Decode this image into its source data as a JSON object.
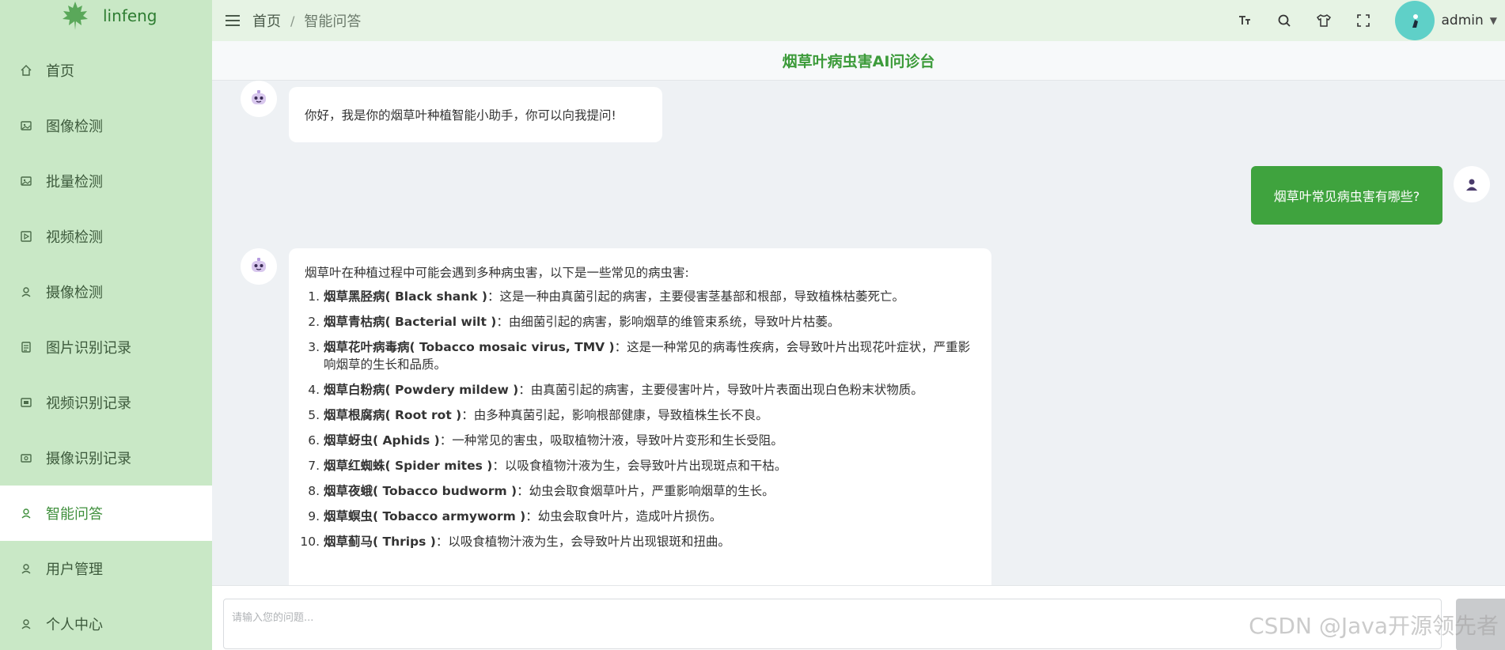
{
  "app": {
    "name": "linfeng"
  },
  "sidebar": {
    "items": [
      {
        "label": "首页",
        "icon": "home-icon"
      },
      {
        "label": "图像检测",
        "icon": "image-icon"
      },
      {
        "label": "批量检测",
        "icon": "image-icon"
      },
      {
        "label": "视频检测",
        "icon": "video-icon"
      },
      {
        "label": "摄像检测",
        "icon": "user-icon"
      },
      {
        "label": "图片识别记录",
        "icon": "document-icon"
      },
      {
        "label": "视频识别记录",
        "icon": "video-record-icon"
      },
      {
        "label": "摄像识别记录",
        "icon": "camera-record-icon"
      },
      {
        "label": "智能问答",
        "icon": "user-icon",
        "active": true
      },
      {
        "label": "用户管理",
        "icon": "user-icon"
      },
      {
        "label": "个人中心",
        "icon": "user-icon"
      }
    ]
  },
  "header": {
    "breadcrumb": [
      "首页",
      "智能问答"
    ],
    "breadcrumb_separator": "/",
    "user_name": "admin"
  },
  "chat": {
    "title": "烟草叶病虫害AI问诊台",
    "greeting": "你好，我是你的烟草叶种植智能小助手，你可以向我提问!",
    "user_question": "烟草叶常见病虫害有哪些?",
    "answer_intro": "烟草叶在种植过程中可能会遇到多种病虫害，以下是一些常见的病虫害:",
    "answer_items": [
      {
        "name": "烟草黑胫病",
        "en": "( Black shank )",
        "desc": "：这是一种由真菌引起的病害，主要侵害茎基部和根部，导致植株枯萎死亡。"
      },
      {
        "name": "烟草青枯病",
        "en": "( Bacterial wilt )",
        "desc": "：由细菌引起的病害，影响烟草的维管束系统，导致叶片枯萎。"
      },
      {
        "name": "烟草花叶病毒病",
        "en": "( Tobacco mosaic virus, TMV )",
        "desc": "：这是一种常见的病毒性疾病，会导致叶片出现花叶症状，严重影响烟草的生长和品质。"
      },
      {
        "name": "烟草白粉病",
        "en": "( Powdery mildew )",
        "desc": "：由真菌引起的病害，主要侵害叶片，导致叶片表面出现白色粉末状物质。"
      },
      {
        "name": "烟草根腐病",
        "en": "( Root rot )",
        "desc": "：由多种真菌引起，影响根部健康，导致植株生长不良。"
      },
      {
        "name": "烟草蚜虫",
        "en": "( Aphids )",
        "desc": "：一种常见的害虫，吸取植物汁液，导致叶片变形和生长受阻。"
      },
      {
        "name": "烟草红蜘蛛",
        "en": "( Spider mites )",
        "desc": "：以吸食植物汁液为生，会导致叶片出现斑点和干枯。"
      },
      {
        "name": "烟草夜蛾",
        "en": "( Tobacco budworm )",
        "desc": "：幼虫会取食烟草叶片，严重影响烟草的生长。"
      },
      {
        "name": "烟草螟虫",
        "en": "( Tobacco armyworm )",
        "desc": "：幼虫会取食叶片，造成叶片损伤。"
      },
      {
        "name": "烟草蓟马",
        "en": "( Thrips )",
        "desc": "：以吸食植物汁液为生，会导致叶片出现银斑和扭曲。"
      }
    ],
    "input_placeholder": "请输入您的问题..."
  },
  "watermark": "CSDN @Java开源领先者",
  "colors": {
    "accent": "#3fa33e",
    "sidebar_bg": "#c9e8c6",
    "topbar_bg": "#e6f3e4"
  }
}
